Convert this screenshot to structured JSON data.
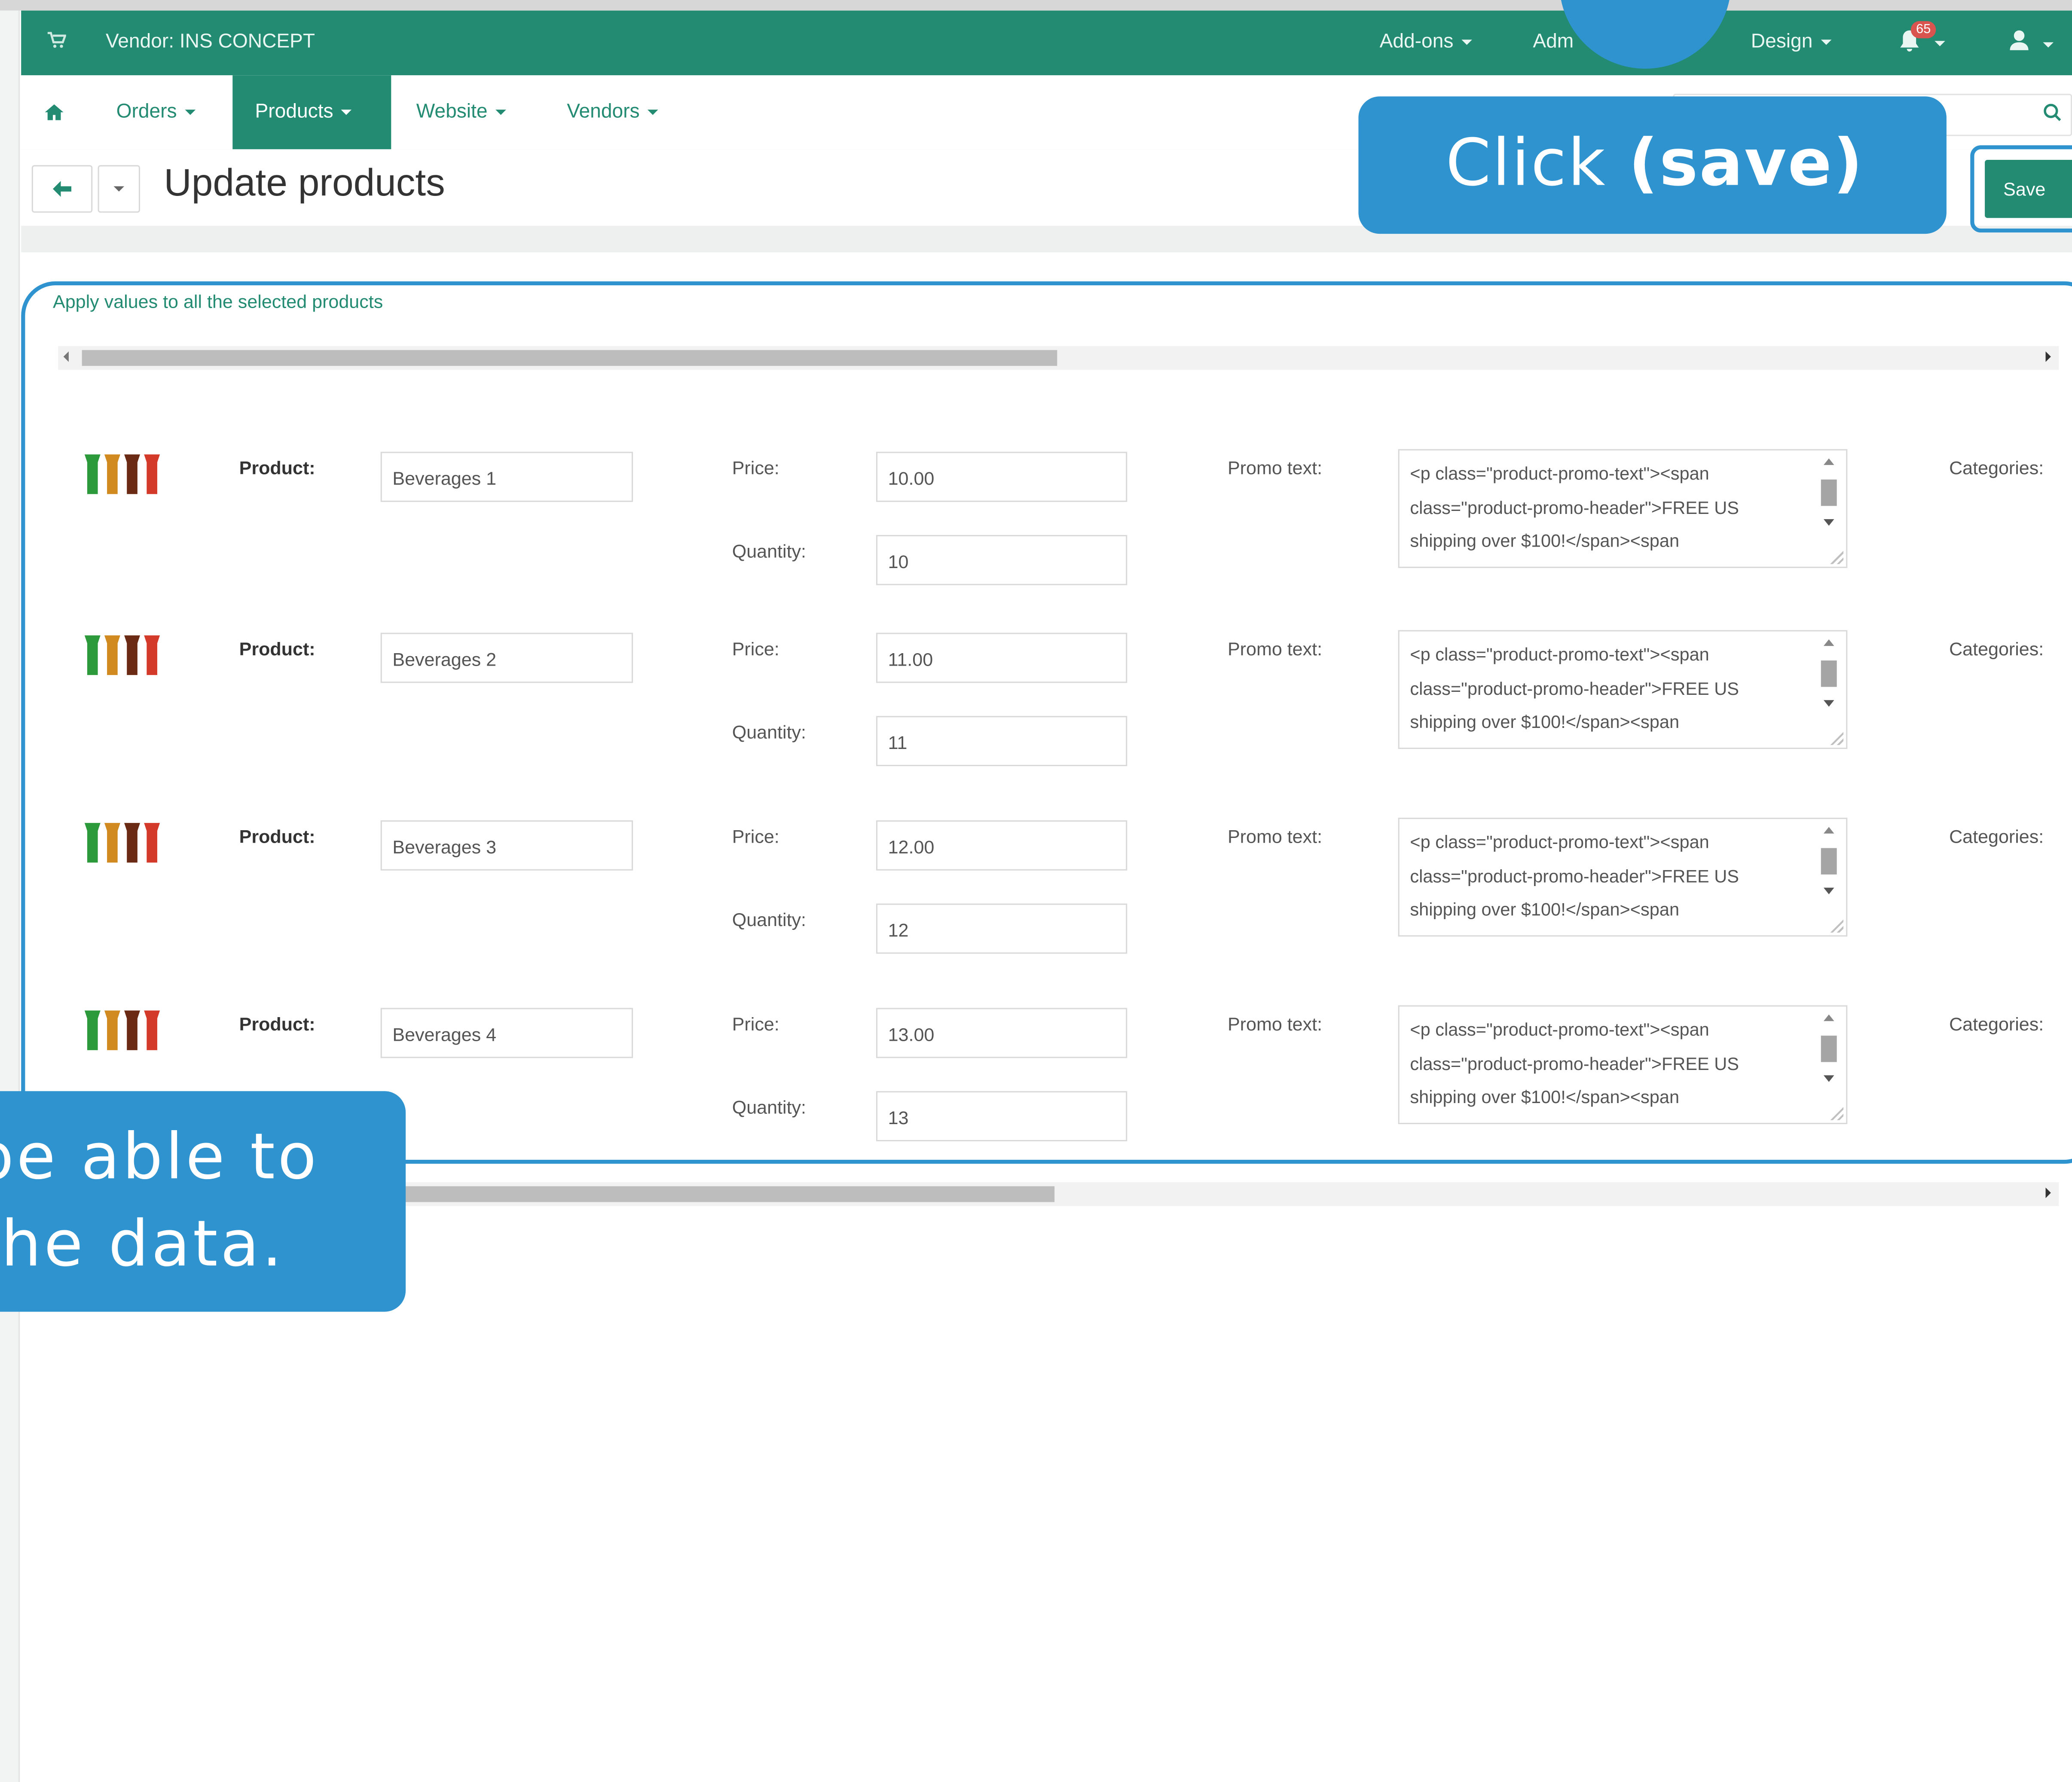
{
  "topbar": {
    "vendor": "Vendor: INS CONCEPT",
    "addons": "Add-ons",
    "administration": "Adm",
    "design": "Design",
    "notification_count": "65"
  },
  "nav": {
    "orders": "Orders",
    "products": "Products",
    "website": "Website",
    "vendors": "Vendors"
  },
  "page": {
    "title": "Update products",
    "save_label": "Save",
    "apply_link": "Apply values to all the selected products"
  },
  "callouts": {
    "save_prefix": "Click ",
    "save_bold": "(save)",
    "bottom_line1": "be able to",
    "bottom_line2": "the  data."
  },
  "labels": {
    "product": "Product:",
    "price": "Price:",
    "quantity": "Quantity:",
    "promo": "Promo text:",
    "categories": "Categories:"
  },
  "products": [
    {
      "name": "Beverages 1",
      "price": "10.00",
      "quantity": "10"
    },
    {
      "name": "Beverages 2",
      "price": "11.00",
      "quantity": "11"
    },
    {
      "name": "Beverages 3",
      "price": "12.00",
      "quantity": "12"
    },
    {
      "name": "Beverages 4",
      "price": "13.00",
      "quantity": "13"
    }
  ],
  "promo_lines": [
    "<p class=\"product-promo-text\"><span",
    "class=\"product-promo-header\">FREE US",
    "shipping over $100!</span><span"
  ],
  "colors": {
    "brand_green": "#228b72",
    "callout_blue": "#2e93cf"
  }
}
